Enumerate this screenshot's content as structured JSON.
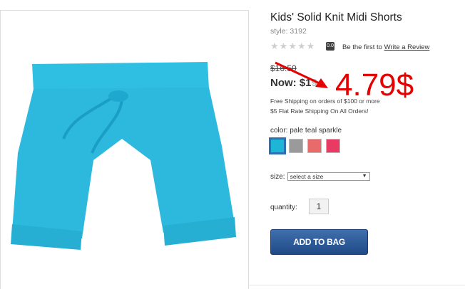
{
  "product": {
    "title": "Kids' Solid Knit Midi Shorts",
    "style": "style: 3192",
    "rating_value": "0.0",
    "be_first_prefix": "Be the first to",
    "write_review": "Write a Review",
    "was_price": "$16.50",
    "now_price": "Now: $1",
    "now_price_suffix": "9",
    "shipping_line1": "Free Shipping on orders of $100 or more",
    "shipping_line2": "$5 Flat Rate Shipping On All Orders!",
    "color_label": "color: pale teal sparkle",
    "swatches": [
      {
        "color": "#1eb6d6",
        "name": "pale teal sparkle",
        "selected": true
      },
      {
        "color": "#9a9a9a",
        "name": "heather gray",
        "selected": false
      },
      {
        "color": "#e86a6a",
        "name": "coral",
        "selected": false
      },
      {
        "color": "#e83a63",
        "name": "pink",
        "selected": false
      }
    ],
    "size_label": "size:",
    "size_placeholder": "select a size",
    "quantity_label": "quantity:",
    "quantity_value": "1",
    "add_to_bag": "ADD TO BAG",
    "image_color": "#2ab8dc"
  },
  "annotation": {
    "price_text": "4.79$",
    "color": "#e60000"
  }
}
